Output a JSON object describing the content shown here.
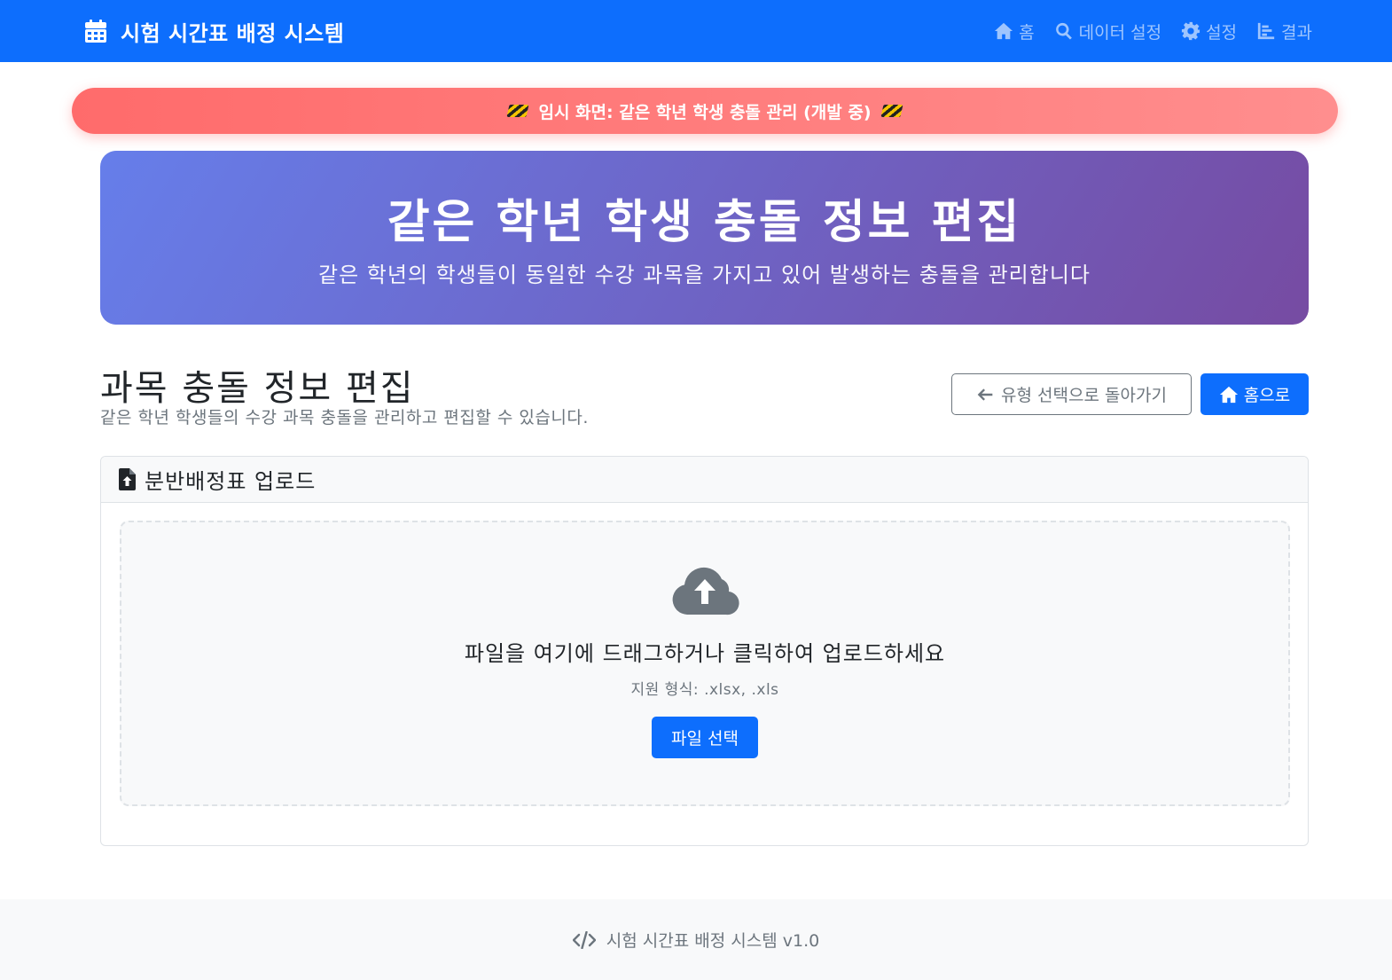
{
  "navbar": {
    "brand": "시험 시간표 배정 시스템",
    "links": [
      {
        "label": "홈",
        "icon": "home-icon"
      },
      {
        "label": "데이터 설정",
        "icon": "search-icon"
      },
      {
        "label": "설정",
        "icon": "gear-icon"
      },
      {
        "label": "결과",
        "icon": "chart-icon"
      }
    ]
  },
  "banner": {
    "text": "임시 화면: 같은 학년 학생 충돌 관리 (개발 중)"
  },
  "hero": {
    "title": "같은 학년 학생 충돌 정보 편집",
    "subtitle": "같은 학년의 학생들이 동일한 수강 과목을 가지고 있어 발생하는 충돌을 관리합니다"
  },
  "section": {
    "title": "과목 충돌 정보 편집",
    "description": "같은 학년 학생들의 수강 과목 충돌을 관리하고 편집할 수 있습니다.",
    "back_label": "유형 선택으로 돌아가기",
    "home_label": "홈으로"
  },
  "upload": {
    "header": "분반배정표 업로드",
    "drop_text": "파일을 여기에 드래그하거나 클릭하여 업로드하세요",
    "formats": "지원 형식: .xlsx, .xls",
    "button_label": "파일 선택"
  },
  "footer": {
    "text": "시험 시간표 배정 시스템 v1.0"
  },
  "colors": {
    "primary": "#0d6efd",
    "banner_start": "#ff6b6b",
    "banner_end": "#ff8e8e",
    "hero_start": "#667eea",
    "hero_end": "#764ba2",
    "muted": "#6c757d"
  }
}
